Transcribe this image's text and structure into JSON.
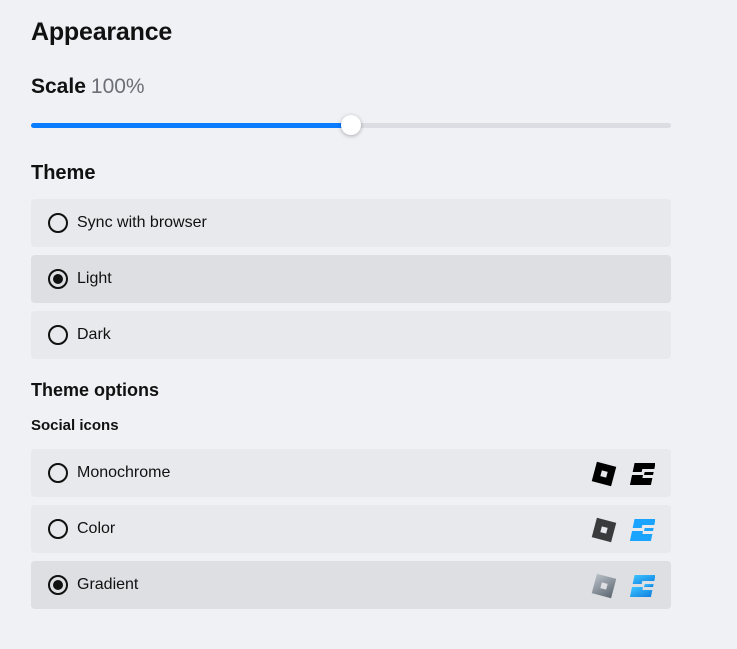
{
  "appearance": {
    "title": "Appearance",
    "scale": {
      "label": "Scale",
      "value": "100%",
      "slider_fraction": 0.5
    },
    "theme": {
      "heading": "Theme",
      "options": [
        {
          "label": "Sync with browser",
          "selected": false
        },
        {
          "label": "Light",
          "selected": true
        },
        {
          "label": "Dark",
          "selected": false
        }
      ]
    },
    "theme_options": {
      "heading": "Theme options",
      "social_icons": {
        "heading": "Social icons",
        "options": [
          {
            "label": "Monochrome",
            "selected": false,
            "icons": [
              "roblox-logo-icon",
              "studio-logo-icon"
            ]
          },
          {
            "label": "Color",
            "selected": false,
            "icons": [
              "roblox-logo-icon",
              "studio-logo-icon"
            ]
          },
          {
            "label": "Gradient",
            "selected": true,
            "icons": [
              "roblox-logo-icon",
              "studio-logo-icon"
            ]
          }
        ]
      }
    }
  },
  "colors": {
    "accent": "#0a7cff",
    "studio_blue": "#1aa3ff",
    "mono": "#000000",
    "color_gray": "#393b3d"
  }
}
